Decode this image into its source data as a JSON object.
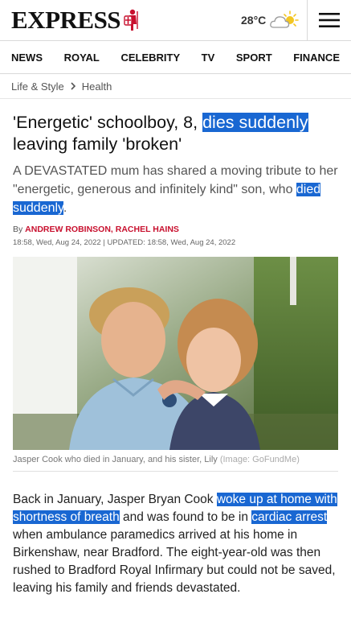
{
  "header": {
    "logo_text": "EXPRESS",
    "temperature": "28°C",
    "weather_icon": "partly-cloudy-icon",
    "menu_icon": "hamburger-menu-icon"
  },
  "nav": {
    "items": [
      "NEWS",
      "ROYAL",
      "CELEBRITY",
      "TV",
      "SPORT",
      "FINANCE"
    ]
  },
  "breadcrumb": {
    "section": "Life & Style",
    "subsection": "Health"
  },
  "article": {
    "headline_part1": "'Energetic' schoolboy, 8, ",
    "headline_highlight": "dies suddenly",
    "headline_part2": " leaving family 'broken'",
    "standfirst_part1": "A DEVASTATED mum has shared a moving tribute to her \"energetic, generous and infinitely kind\" son, who ",
    "standfirst_highlight": "died suddenly",
    "standfirst_part2": ".",
    "byline_prefix": "By ",
    "author1": "ANDREW ROBINSON",
    "byline_sep": ", ",
    "author2": "RACHEL HAINS",
    "published": "18:58, Wed, Aug 24, 2022",
    "updated_label": " | UPDATED: ",
    "updated": "18:58, Wed, Aug 24, 2022",
    "image_caption": "Jasper Cook who died in January, and his sister, Lily",
    "image_credit": " (Image: GoFundMe)",
    "body_1": "Back in January, Jasper Bryan Cook ",
    "body_hl1": "woke up at home with shortness of breath",
    "body_2": " and was found to be in ",
    "body_hl2": "cardiac arrest",
    "body_3": " when ambulance paramedics arrived at his home in Birkenshaw, near Bradford. The eight-year-old was then rushed to Bradford Royal Infirmary but could not be saved, leaving his family and friends devastated."
  },
  "colors": {
    "highlight": "#1967d2",
    "author": "#c8102e"
  }
}
